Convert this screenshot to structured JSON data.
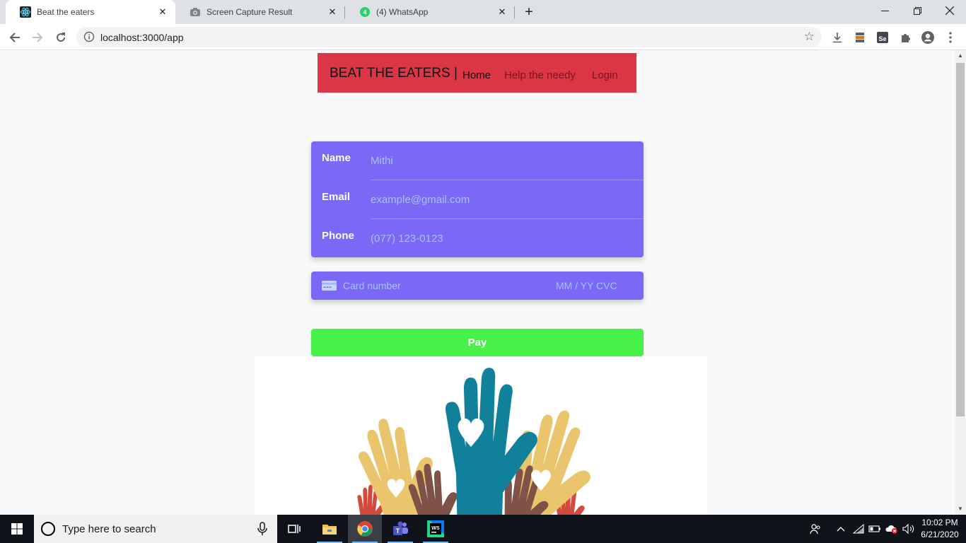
{
  "browser": {
    "tabs": [
      {
        "title": "Beat the eaters",
        "icon": "react-icon",
        "active": true
      },
      {
        "title": "Screen Capture Result",
        "icon": "camera-icon",
        "active": false
      },
      {
        "title": "(4) WhatsApp",
        "icon": "whatsapp-icon",
        "active": false
      }
    ],
    "url": "localhost:3000/app"
  },
  "navbar": {
    "brand": "BEAT THE EATERS |",
    "links": [
      {
        "label": "Home",
        "active": true
      },
      {
        "label": "Help the needy",
        "active": false
      },
      {
        "label": "Login",
        "active": false
      }
    ],
    "color": "#dc3545"
  },
  "billing_form": {
    "fields": [
      {
        "label": "Name",
        "placeholder": "Mithi"
      },
      {
        "label": "Email",
        "placeholder": "example@gmail.com"
      },
      {
        "label": "Phone",
        "placeholder": "(077) 123-0123"
      }
    ],
    "color": "#7b68f6"
  },
  "card": {
    "number_placeholder": "Card number",
    "expiry_cvc_placeholder": "MM / YY  CVC"
  },
  "pay_button": {
    "label": "Pay",
    "color": "#47f147"
  },
  "taskbar": {
    "search_placeholder": "Type here to search",
    "time": "10:02 PM",
    "date": "6/21/2020"
  }
}
